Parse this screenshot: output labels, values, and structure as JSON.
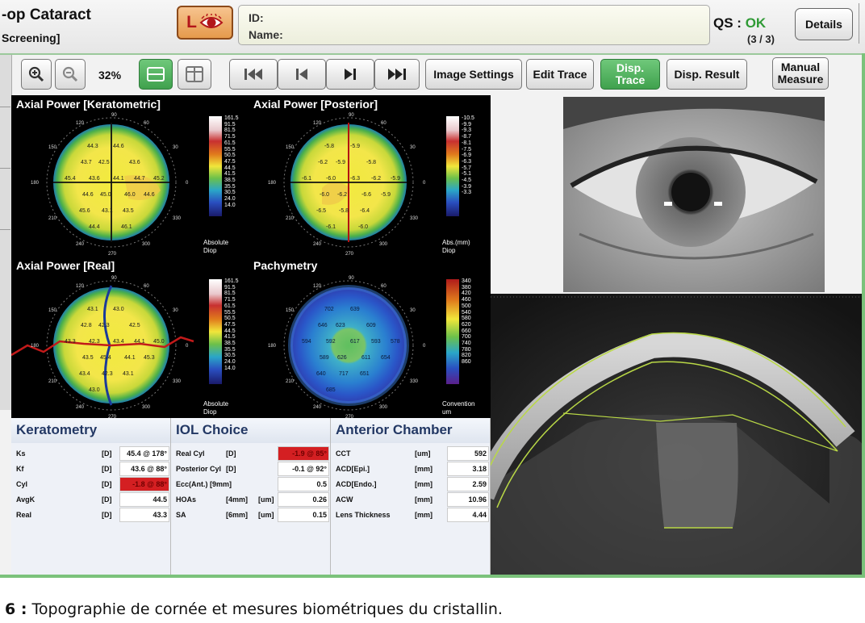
{
  "header": {
    "mode_title": "-op Cataract",
    "mode_subtitle": "Screening]",
    "eye_letter": "L",
    "id_label": "ID:",
    "name_label": "Name:",
    "qs_label": "QS :",
    "qs_status": "OK",
    "qs_count": "(3 / 3)",
    "details_label": "Details"
  },
  "toolbar": {
    "zoom_level": "32%",
    "image_settings": "Image Settings",
    "edit_trace": "Edit Trace",
    "disp_trace": "Disp. Trace",
    "disp_result": "Disp. Result",
    "manual_measure": "Manual Measure"
  },
  "maps": [
    {
      "title": "Axial Power [Keratometric]",
      "scale_values": [
        "161.5",
        "91.5",
        "81.5",
        "71.5",
        "61.5",
        "55.5",
        "50.5",
        "47.5",
        "44.5",
        "41.5",
        "38.5",
        "35.5",
        "30.5",
        "24.0",
        "14.0"
      ],
      "scale_unit": [
        "Absolute",
        "Diop"
      ],
      "overlay_values": [
        "44.3",
        "44.6",
        "43.7",
        "42.5",
        "43.6",
        "45.4",
        "43.6",
        "44.1",
        "44.7",
        "45.2",
        "44.6",
        "45.0",
        "46.0",
        "44.6",
        "45.6",
        "43.1",
        "43.5",
        "44.4",
        "46.1"
      ],
      "angles": [
        "90",
        "120",
        "60",
        "150",
        "30",
        "180",
        "0",
        "210",
        "330",
        "240",
        "270",
        "300"
      ]
    },
    {
      "title": "Axial Power [Posterior]",
      "scale_values": [
        "-10.5",
        "-9.9",
        "-9.3",
        "-8.7",
        "-8.1",
        "-7.5",
        "-6.9",
        "-6.3",
        "-5.7",
        "-5.1",
        "-4.5",
        "-3.9",
        "-3.3"
      ],
      "scale_unit": [
        "Abs.(mm)",
        "Diop"
      ],
      "overlay_values": [
        "-5.8",
        "-5.9",
        "-6.2",
        "-5.9",
        "-5.8",
        "-6.1",
        "-6.0",
        "-6.3",
        "-6.2",
        "-5.9",
        "-6.0",
        "-6.2",
        "-6.6",
        "-5.9",
        "-6.5",
        "-5.8",
        "-6.4",
        "-6.1",
        "-6.0"
      ],
      "angles": [
        "90",
        "120",
        "60",
        "150",
        "30",
        "180",
        "0",
        "210",
        "330",
        "240",
        "270",
        "300"
      ]
    },
    {
      "title": "Axial Power [Real]",
      "scale_values": [
        "161.5",
        "91.5",
        "81.5",
        "71.5",
        "61.5",
        "55.5",
        "50.5",
        "47.5",
        "44.5",
        "41.5",
        "38.5",
        "35.5",
        "30.5",
        "24.0",
        "14.0"
      ],
      "scale_unit": [
        "Absolute",
        "Diop"
      ],
      "overlay_values": [
        "43.1",
        "43.0",
        "42.8",
        "42.3",
        "42.5",
        "43.3",
        "42.3",
        "43.4",
        "44.1",
        "45.0",
        "43.5",
        "45.4",
        "44.1",
        "45.3",
        "43.4",
        "42.3",
        "43.1",
        "43.0"
      ],
      "angles": [
        "90",
        "120",
        "60",
        "150",
        "30",
        "180",
        "0",
        "210",
        "330",
        "240",
        "270",
        "300"
      ]
    },
    {
      "title": "Pachymetry",
      "scale_values": [
        "340",
        "380",
        "420",
        "460",
        "500",
        "540",
        "580",
        "620",
        "660",
        "700",
        "740",
        "780",
        "820",
        "860"
      ],
      "scale_unit": [
        "Convention",
        "um"
      ],
      "overlay_values": [
        "702",
        "639",
        "646",
        "623",
        "609",
        "594",
        "592",
        "617",
        "593",
        "578",
        "589",
        "626",
        "611",
        "654",
        "640",
        "717",
        "651",
        "685"
      ],
      "angles": [
        "90",
        "120",
        "60",
        "150",
        "30",
        "180",
        "0",
        "210",
        "330",
        "240",
        "270",
        "300"
      ]
    }
  ],
  "keratometry": {
    "title": "Keratometry",
    "rows": [
      {
        "label": "Ks",
        "unit": "[D]",
        "value": "45.4 @ 178°",
        "highlight": false
      },
      {
        "label": "Kf",
        "unit": "[D]",
        "value": "43.6 @ 88°",
        "highlight": false
      },
      {
        "label": "Cyl",
        "unit": "[D]",
        "value": "-1.8 @ 88°",
        "highlight": true
      },
      {
        "label": "AvgK",
        "unit": "[D]",
        "value": "44.5",
        "highlight": false
      },
      {
        "label": "Real",
        "unit": "[D]",
        "value": "43.3",
        "highlight": false
      }
    ]
  },
  "iol_choice": {
    "title": "IOL Choice",
    "rows": [
      {
        "label": "Real Cyl",
        "unit": "[D]",
        "value": "-1.9 @ 85°",
        "highlight": true
      },
      {
        "label": "Posterior Cyl",
        "unit": "[D]",
        "value": "-0.1 @ 92°",
        "highlight": false
      },
      {
        "label": "Ecc(Ant.) [9mm]",
        "unit": "",
        "value": "0.5",
        "highlight": false
      },
      {
        "label": "HOAs",
        "unit": "[4mm]",
        "unit2": "[um]",
        "value": "0.26",
        "highlight": false
      },
      {
        "label": "SA",
        "unit": "[6mm]",
        "unit2": "[um]",
        "value": "0.15",
        "highlight": false
      }
    ]
  },
  "anterior_chamber": {
    "title": "Anterior Chamber",
    "rows": [
      {
        "label": "CCT",
        "unit": "[um]",
        "value": "592",
        "highlight": false
      },
      {
        "label": "ACD[Epi.]",
        "unit": "[mm]",
        "value": "3.18",
        "highlight": false
      },
      {
        "label": "ACD[Endo.]",
        "unit": "[mm]",
        "value": "2.59",
        "highlight": false
      },
      {
        "label": "ACW",
        "unit": "[mm]",
        "value": "10.96",
        "highlight": false
      },
      {
        "label": "Lens Thickness",
        "unit": "[mm]",
        "value": "4.44",
        "highlight": false
      }
    ]
  },
  "caption": {
    "number": "6 :",
    "text": "Topographie de cornée et mesures biométriques du cristallin."
  },
  "colors": {
    "accent_green": "#4caf50",
    "highlight_red": "#d41f22",
    "table_title": "#233864",
    "eye_button": "#e59a4c"
  },
  "icons": [
    "eye-icon",
    "zoom-in-icon",
    "zoom-out-icon",
    "single-view-icon",
    "split-view-icon",
    "first-icon",
    "previous-icon",
    "next-icon",
    "last-icon"
  ]
}
